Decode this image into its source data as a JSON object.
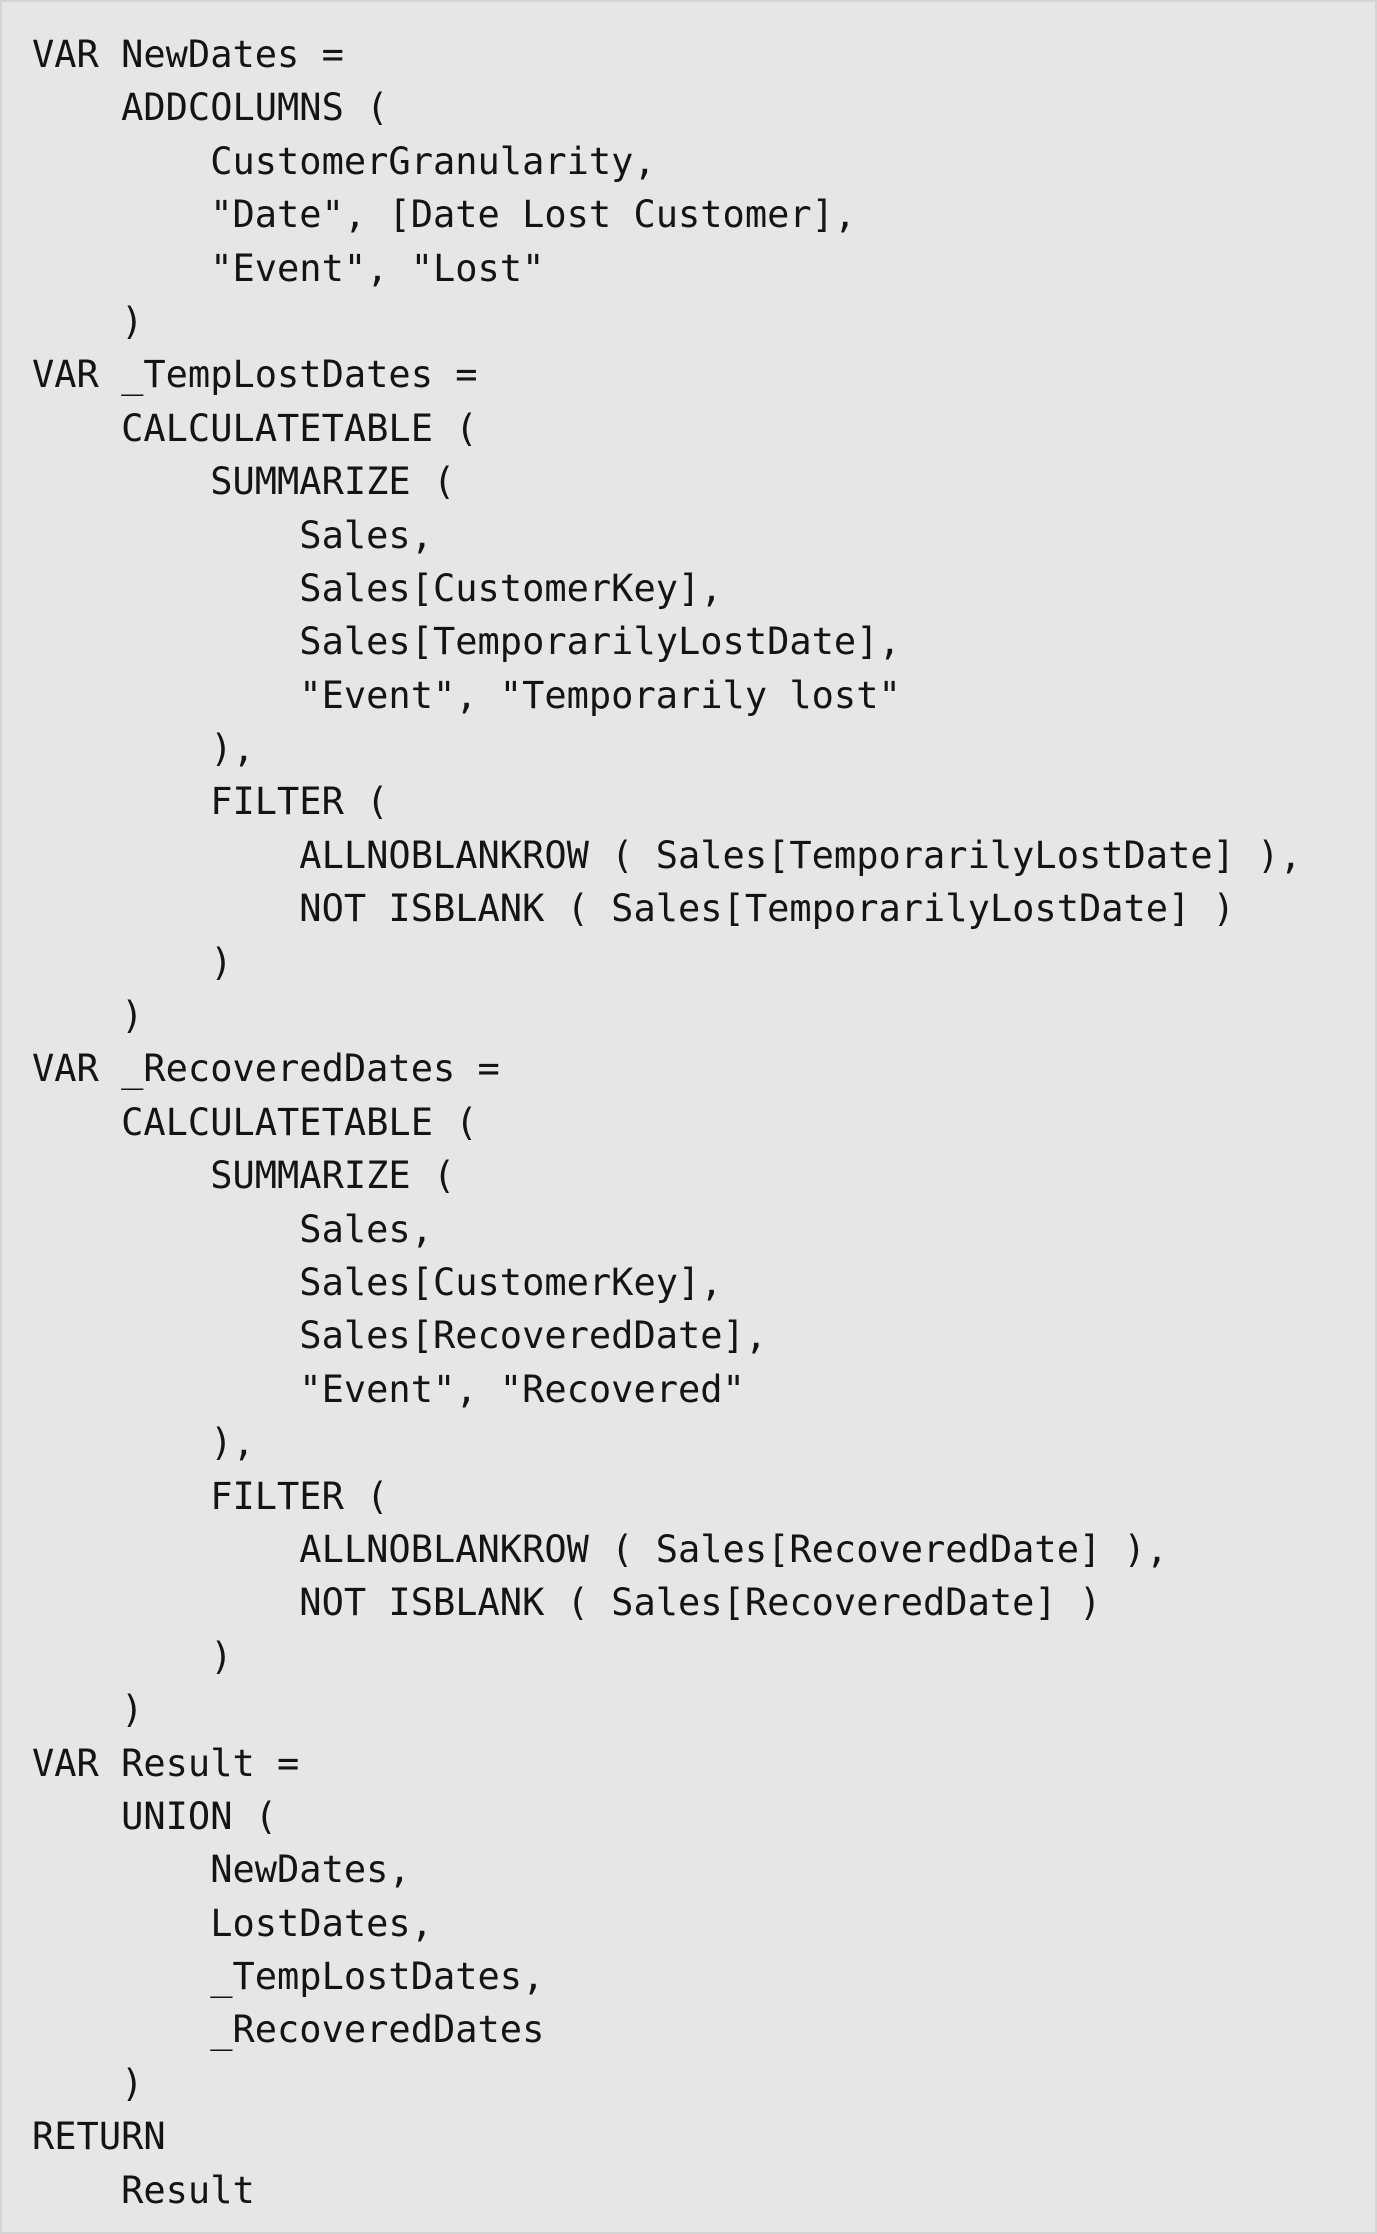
{
  "code": {
    "language": "DAX",
    "lines": [
      "VAR NewDates =",
      "    ADDCOLUMNS (",
      "        CustomerGranularity,",
      "        \"Date\", [Date Lost Customer],",
      "        \"Event\", \"Lost\"",
      "    )",
      "VAR _TempLostDates =",
      "    CALCULATETABLE (",
      "        SUMMARIZE (",
      "            Sales,",
      "            Sales[CustomerKey],",
      "            Sales[TemporarilyLostDate],",
      "            \"Event\", \"Temporarily lost\"",
      "        ),",
      "        FILTER (",
      "            ALLNOBLANKROW ( Sales[TemporarilyLostDate] ),",
      "            NOT ISBLANK ( Sales[TemporarilyLostDate] )",
      "        )",
      "    )",
      "VAR _RecoveredDates =",
      "    CALCULATETABLE (",
      "        SUMMARIZE (",
      "            Sales,",
      "            Sales[CustomerKey],",
      "            Sales[RecoveredDate],",
      "            \"Event\", \"Recovered\"",
      "        ),",
      "        FILTER (",
      "            ALLNOBLANKROW ( Sales[RecoveredDate] ),",
      "            NOT ISBLANK ( Sales[RecoveredDate] )",
      "        )",
      "    )",
      "VAR Result =",
      "    UNION (",
      "        NewDates,",
      "        LostDates,",
      "        _TempLostDates,",
      "        _RecoveredDates",
      "    )",
      "RETURN",
      "    Result"
    ]
  },
  "colors": {
    "panel_background": "#e6e6e6",
    "text": "#141414"
  }
}
